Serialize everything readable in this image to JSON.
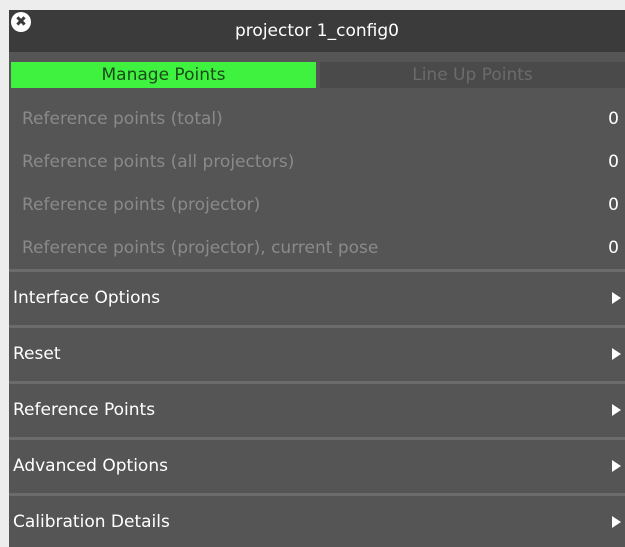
{
  "window": {
    "title": "projector 1_config0",
    "close_icon": "✖"
  },
  "tabs": [
    {
      "label": "Manage Points",
      "active": true
    },
    {
      "label": "Line Up Points",
      "active": false
    }
  ],
  "stats": [
    {
      "label": "Reference points (total)",
      "value": "0"
    },
    {
      "label": "Reference points (all projectors)",
      "value": "0"
    },
    {
      "label": "Reference points (projector)",
      "value": "0"
    },
    {
      "label": "Reference points (projector), current pose",
      "value": "0"
    }
  ],
  "sections": [
    {
      "label": "Interface Options",
      "icon": "triangle-right-icon"
    },
    {
      "label": "Reset",
      "icon": "triangle-right-icon"
    },
    {
      "label": "Reference Points",
      "icon": "triangle-right-icon"
    },
    {
      "label": "Advanced Options",
      "icon": "triangle-right-icon"
    },
    {
      "label": "Calibration Details",
      "icon": "triangle-right-icon"
    }
  ],
  "colors": {
    "accent": "#3ff23f",
    "panel_bg": "#555555",
    "titlebar_bg": "#3b3b3b"
  }
}
